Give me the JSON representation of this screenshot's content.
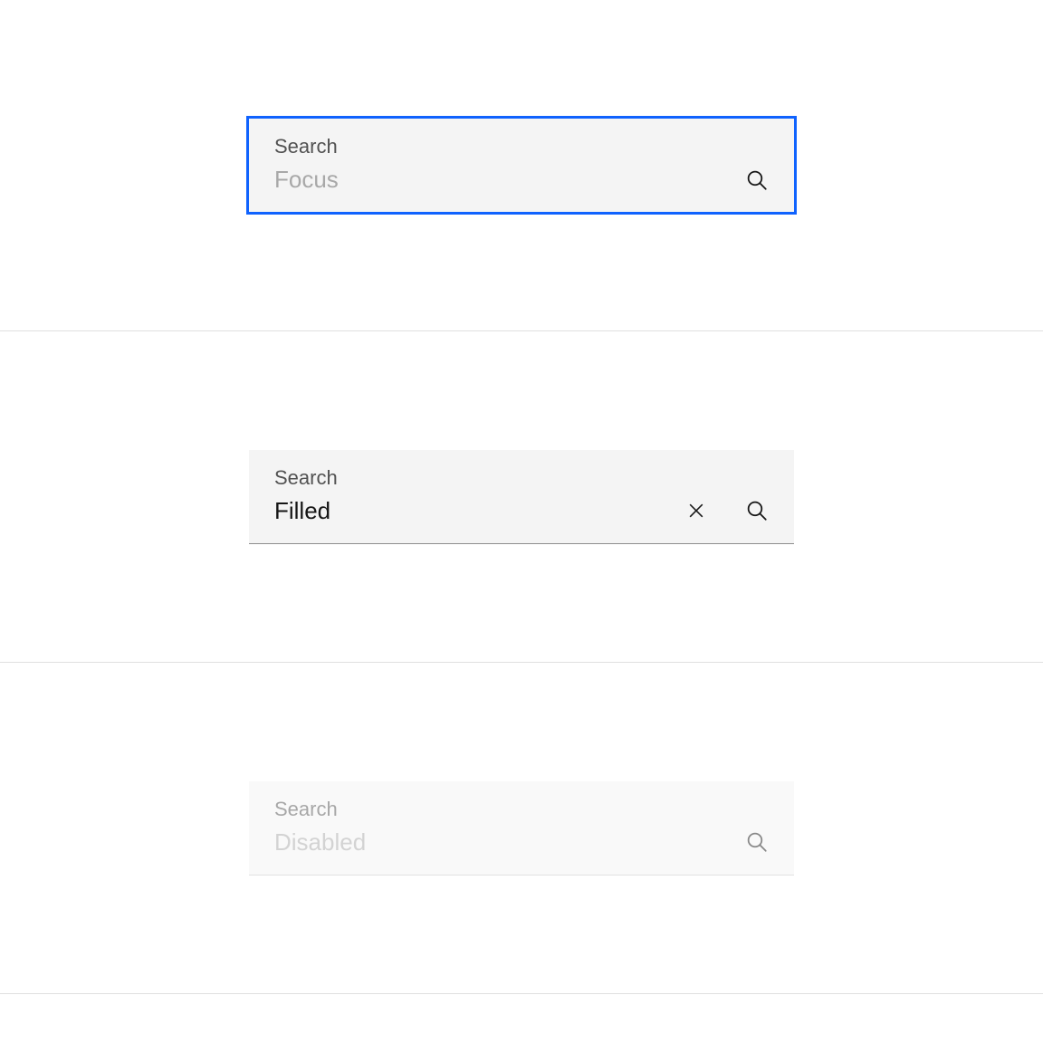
{
  "focus": {
    "label": "Search",
    "placeholder": "Focus",
    "value": ""
  },
  "filled": {
    "label": "Search",
    "placeholder": "",
    "value": "Filled"
  },
  "disabled": {
    "label": "Search",
    "placeholder": "Disabled",
    "value": ""
  },
  "colors": {
    "focus_outline": "#0f62fe",
    "field_bg": "#f4f4f4",
    "text": "#161616",
    "placeholder": "#a8a8a8",
    "label": "#525252"
  }
}
